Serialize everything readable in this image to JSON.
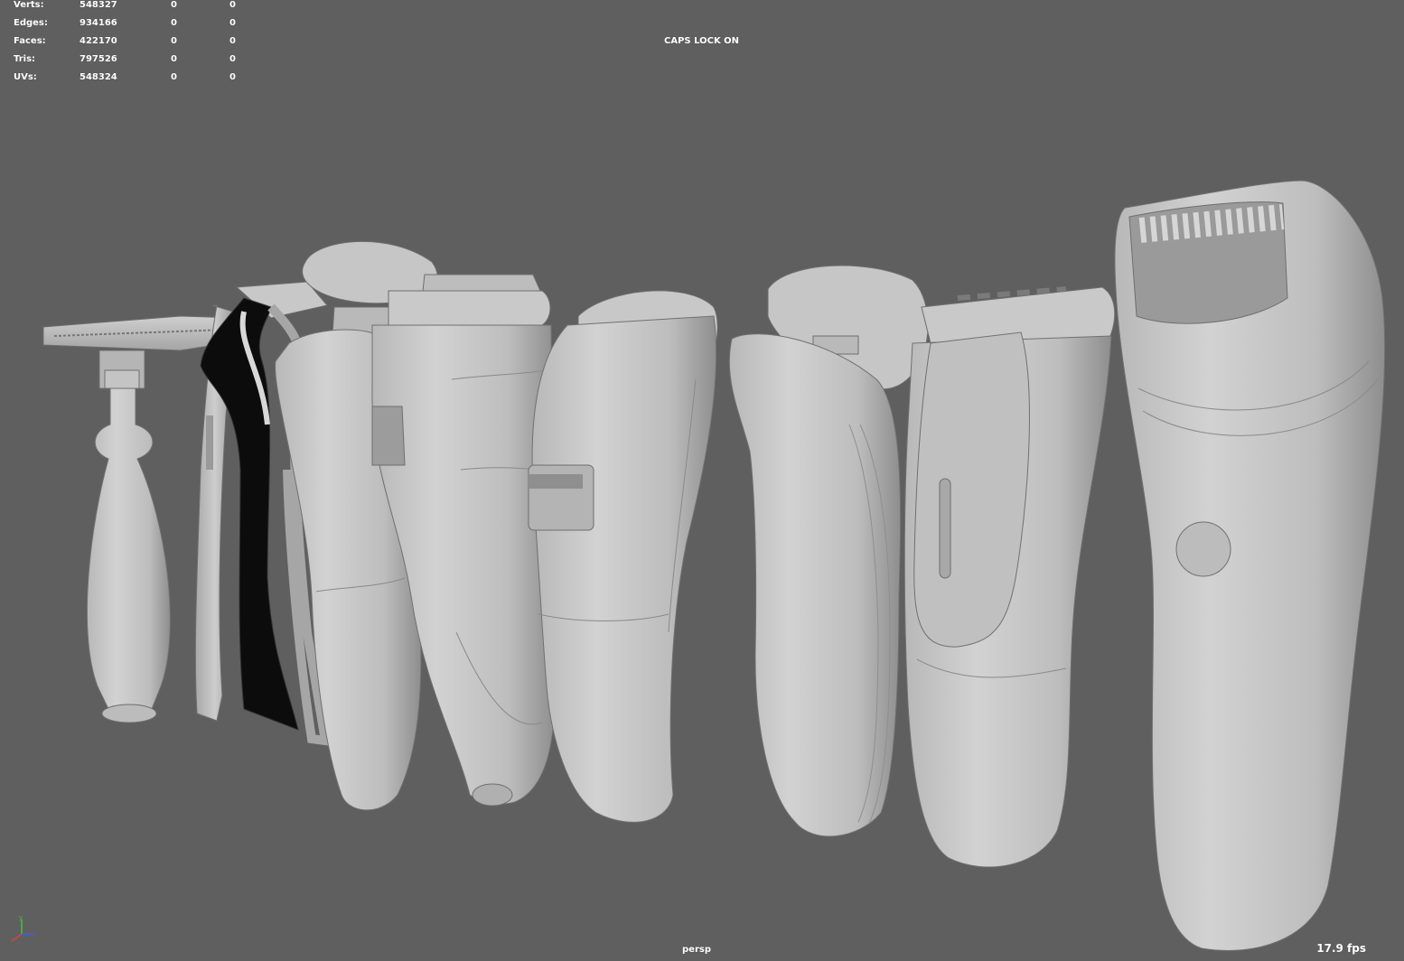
{
  "stats": [
    {
      "label": "Verts:",
      "total": "548327",
      "selected": "0",
      "extra": "0"
    },
    {
      "label": "Edges:",
      "total": "934166",
      "selected": "0",
      "extra": "0"
    },
    {
      "label": "Faces:",
      "total": "422170",
      "selected": "0",
      "extra": "0"
    },
    {
      "label": "Tris:",
      "total": "797526",
      "selected": "0",
      "extra": "0"
    },
    {
      "label": "UVs:",
      "total": "548324",
      "selected": "0",
      "extra": "0"
    }
  ],
  "status": {
    "caps_lock": "CAPS LOCK ON",
    "camera": "persp",
    "fps": "17.9 fps"
  },
  "axis": {
    "y": "y",
    "x": "x",
    "z": "z"
  },
  "colors": {
    "background": "#5f5f5f",
    "model_light": "#cfcfcf",
    "model_mid": "#a9a9a9",
    "model_dark": "#7c7c7c",
    "axis_x": "#e04040",
    "axis_y": "#40c040",
    "axis_z": "#4060e0"
  },
  "scene": {
    "objects": [
      "safety-razor",
      "cartridge-razor-white",
      "cartridge-razor-black",
      "rotary-shaver-1",
      "foil-shaver-1",
      "foil-shaver-2",
      "rotary-shaver-2",
      "foil-shaver-3",
      "epilator"
    ]
  }
}
